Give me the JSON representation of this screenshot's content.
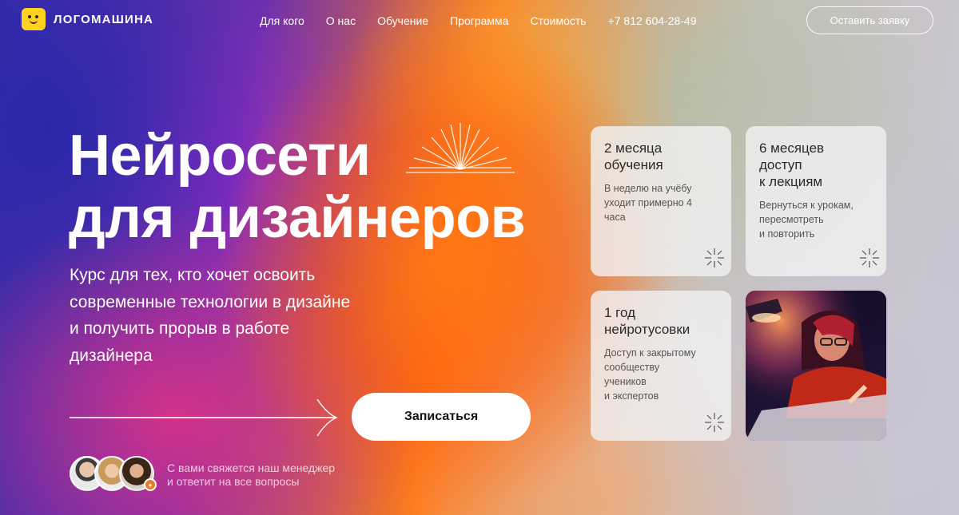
{
  "header": {
    "logo_text": "ЛОГОМАШИНА",
    "nav": [
      "Для кого",
      "О нас",
      "Обучение",
      "Программа",
      "Стоимость",
      "+7 812 604-28-49"
    ],
    "cta_label": "Оставить заявку"
  },
  "hero": {
    "title_line1": "Нейросети",
    "title_line2": "для дизайнеров",
    "subtitle_lines": [
      "Курс для тех, кто хочет освоить",
      "современные технологии в дизайне",
      "и получить прорыв в работе",
      "дизайнера"
    ],
    "enroll_label": "Записаться",
    "manager_line1": "С вами свяжется наш менеджер",
    "manager_line2": "и ответит на все вопросы"
  },
  "cards": [
    {
      "title_lines": [
        "2 месяца",
        "обучения"
      ],
      "desc_lines": [
        "В неделю на учёбу",
        "уходит примерно 4",
        "часа"
      ]
    },
    {
      "title_lines": [
        "6 месяцев",
        "доступ",
        "к лекциям"
      ],
      "desc_lines": [
        "Вернуться к урокам,",
        "пересмотреть",
        "и повторить"
      ]
    },
    {
      "title_lines": [
        "1 год",
        "нейротусовки"
      ],
      "desc_lines": [
        "Доступ к закрытому",
        "сообществу",
        "учеников",
        "и экспертов"
      ]
    }
  ],
  "colors": {
    "accent_logo": "#ffd21f",
    "badge": "#f07a20",
    "button_bg": "#ffffff"
  }
}
